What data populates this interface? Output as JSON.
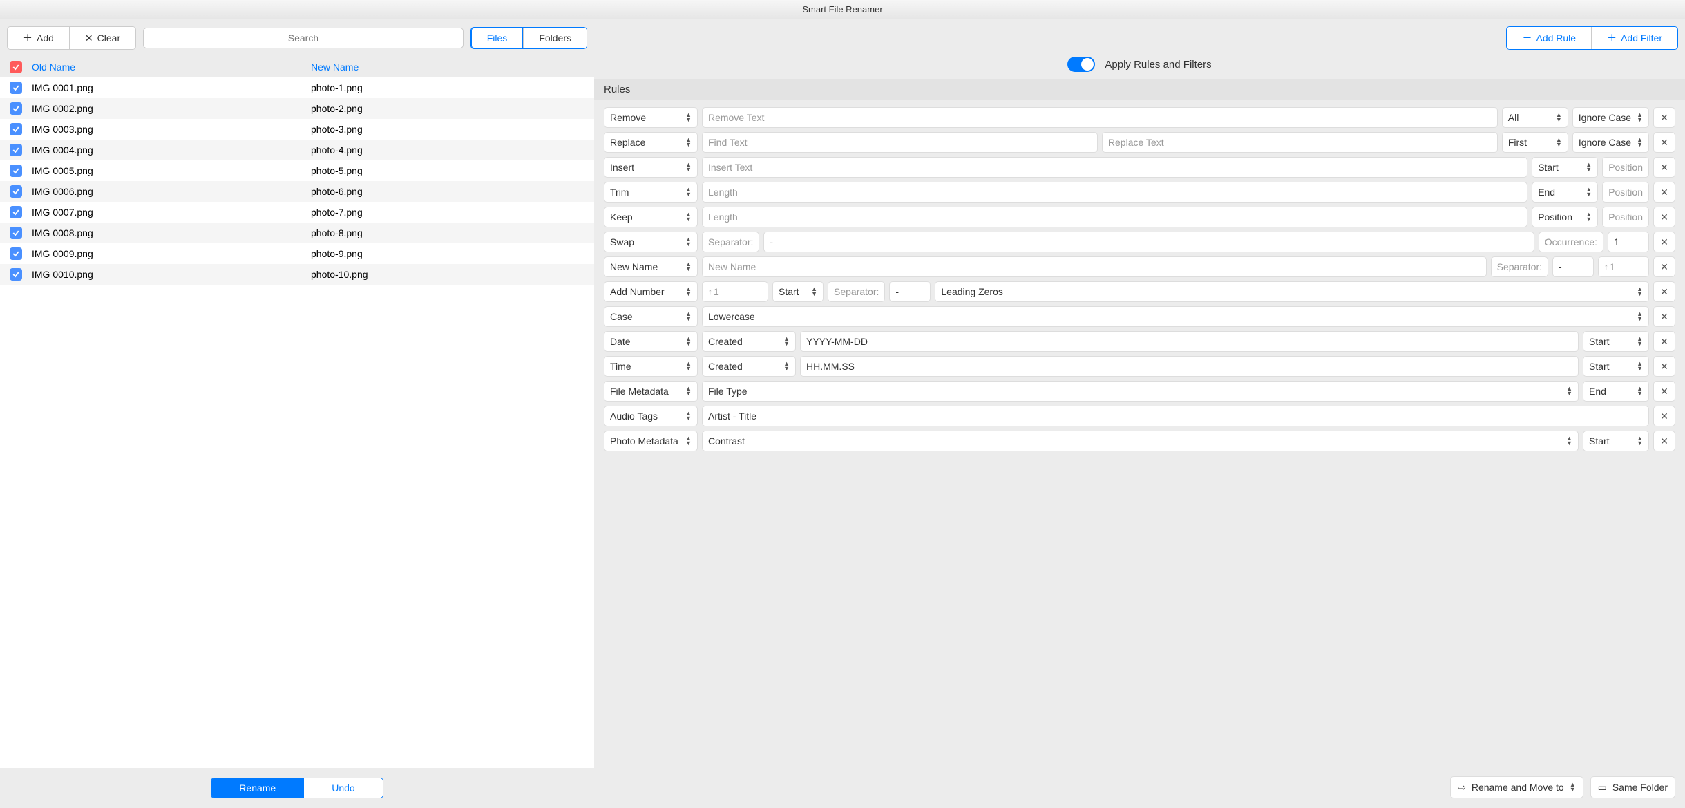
{
  "title": "Smart File Renamer",
  "toolbar": {
    "add": "Add",
    "clear": "Clear",
    "search_placeholder": "Search",
    "files": "Files",
    "folders": "Folders"
  },
  "columns": {
    "old": "Old Name",
    "new": "New Name"
  },
  "files": [
    {
      "old": "IMG 0001.png",
      "new": "photo-1.png"
    },
    {
      "old": "IMG 0002.png",
      "new": "photo-2.png"
    },
    {
      "old": "IMG 0003.png",
      "new": "photo-3.png"
    },
    {
      "old": "IMG 0004.png",
      "new": "photo-4.png"
    },
    {
      "old": "IMG 0005.png",
      "new": "photo-5.png"
    },
    {
      "old": "IMG 0006.png",
      "new": "photo-6.png"
    },
    {
      "old": "IMG 0007.png",
      "new": "photo-7.png"
    },
    {
      "old": "IMG 0008.png",
      "new": "photo-8.png"
    },
    {
      "old": "IMG 0009.png",
      "new": "photo-9.png"
    },
    {
      "old": "IMG 0010.png",
      "new": "photo-10.png"
    }
  ],
  "actions": {
    "rename": "Rename",
    "undo": "Undo"
  },
  "right": {
    "add_rule": "Add Rule",
    "add_filter": "Add Filter",
    "apply": "Apply Rules and Filters",
    "rules_header": "Rules",
    "move_to": "Rename and Move to",
    "same_folder": "Same Folder"
  },
  "opts": {
    "all": "All",
    "first": "First",
    "start": "Start",
    "end": "End",
    "position": "Position",
    "ignore_case": "Ignore Case",
    "leading_zeros": "Leading Zeros",
    "created": "Created",
    "lowercase": "Lowercase",
    "file_type": "File Type",
    "artist_title": "Artist - Title",
    "contrast": "Contrast"
  },
  "rules": [
    {
      "type": "Remove",
      "p1": "Remove Text"
    },
    {
      "type": "Replace",
      "p1": "Find Text",
      "p2": "Replace Text"
    },
    {
      "type": "Insert",
      "p1": "Insert Text",
      "p3": "Position"
    },
    {
      "type": "Trim",
      "p1": "Length",
      "p3": "Position"
    },
    {
      "type": "Keep",
      "p1": "Length",
      "p3": "Position"
    },
    {
      "type": "Swap",
      "sep_lbl": "Separator:",
      "sep": "-",
      "occ_lbl": "Occurrence:",
      "occ": "1"
    },
    {
      "type": "New Name",
      "p1": "New Name",
      "sep_lbl": "Separator:",
      "sep": "-",
      "num": "1"
    },
    {
      "type": "Add Number",
      "num": "1",
      "sep_lbl": "Separator:",
      "sep": "-"
    },
    {
      "type": "Case"
    },
    {
      "type": "Date",
      "fmt": "YYYY-MM-DD"
    },
    {
      "type": "Time",
      "fmt": "HH.MM.SS"
    },
    {
      "type": "File Metadata"
    },
    {
      "type": "Audio Tags"
    },
    {
      "type": "Photo Metadata"
    }
  ]
}
